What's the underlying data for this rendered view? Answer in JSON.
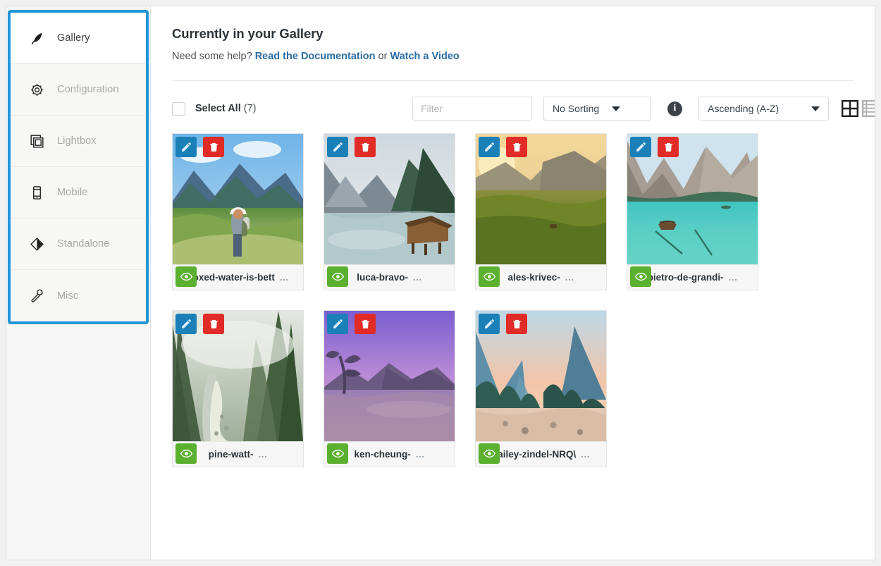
{
  "sidebar": {
    "items": [
      {
        "label": "Gallery",
        "icon": "leaf-icon",
        "active": true
      },
      {
        "label": "Configuration",
        "icon": "gear-icon",
        "active": false
      },
      {
        "label": "Lightbox",
        "icon": "layers-icon",
        "active": false
      },
      {
        "label": "Mobile",
        "icon": "phone-icon",
        "active": false
      },
      {
        "label": "Standalone",
        "icon": "diamond-icon",
        "active": false
      },
      {
        "label": "Misc",
        "icon": "wrench-icon",
        "active": false
      }
    ]
  },
  "main": {
    "title": "Currently in your Gallery",
    "help_prefix": "Need some help? ",
    "help_link_1": "Read the Documentation",
    "help_middle": " or ",
    "help_link_2": "Watch a Video",
    "toolbar": {
      "select_all_label": "Select All",
      "select_all_count": "(7)",
      "filter_placeholder": "Filter",
      "sort_value": "No Sorting",
      "direction_value": "Ascending (A-Z)",
      "info_glyph": "i",
      "grid_view_active": true,
      "list_view_active": false
    },
    "cards": [
      {
        "name": "boxed-water-is-bett",
        "dots": "...",
        "scene": "hiker-meadow"
      },
      {
        "name": "luca-bravo-",
        "dots": "...",
        "scene": "lake-cabin"
      },
      {
        "name": "ales-krivec-",
        "dots": "...",
        "scene": "golden-field"
      },
      {
        "name": "pietro-de-grandi-",
        "dots": "...",
        "scene": "turquoise-lake"
      },
      {
        "name": "pine-watt-",
        "dots": "...",
        "scene": "misty-forest"
      },
      {
        "name": "ken-cheung-",
        "dots": "...",
        "scene": "purple-dusk"
      },
      {
        "name": "bailey-zindel-NRQ\\",
        "dots": "...",
        "scene": "valley-sunrise"
      }
    ]
  },
  "colors": {
    "accent_blue": "#2196d9",
    "link_blue": "#2b6ca3",
    "edit_blue": "#1b7fb8",
    "delete_red": "#e02b27",
    "view_green": "#5bb02f"
  }
}
